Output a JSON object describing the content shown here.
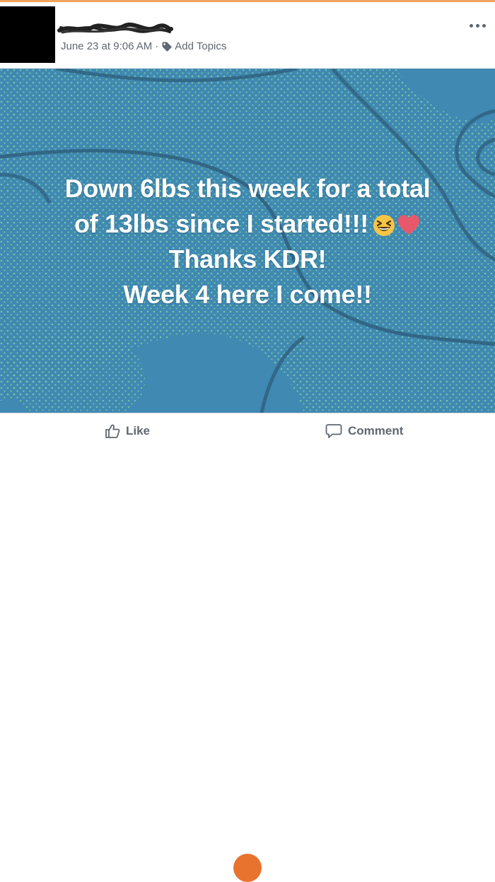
{
  "header": {
    "author_name": "",
    "date": "June 23 at 9:06 AM",
    "separator": "·",
    "add_topics": "Add Topics"
  },
  "post": {
    "lines": [
      "Down 6lbs this week for a total",
      "of 13lbs since I started!!!",
      "Thanks KDR!",
      "Week 4 here I come!!"
    ],
    "emojis": [
      "grinning-squinting-face",
      "red-heart"
    ],
    "background_color": "#3f89b2",
    "dot_color": "#7ec8a6"
  },
  "actions": {
    "like_label": "Like",
    "comment_label": "Comment"
  },
  "colors": {
    "top_strip": "#f0a35a",
    "meta_text": "#616770",
    "action_text": "#606770"
  }
}
